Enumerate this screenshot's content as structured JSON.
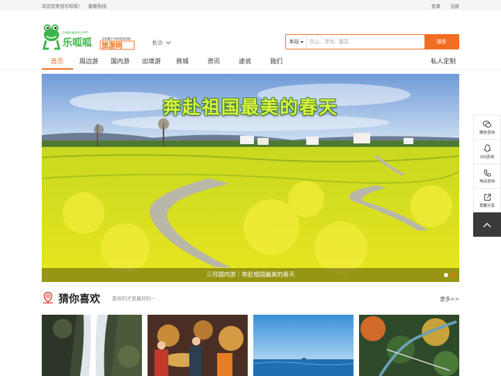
{
  "topbar": {
    "welcome": "欢迎您来到乐呱呱！",
    "hotline": "客服热线:",
    "login": "登录",
    "register": "注册"
  },
  "logo": {
    "brand": "乐呱呱",
    "domain": "Leguagua.com",
    "slogan": "定制属于你的旅游线路",
    "site": "旅游网"
  },
  "city": "长沙",
  "search": {
    "scope": "本站",
    "placeholder": "凤山、漂流、露营",
    "button": "搜索"
  },
  "nav": {
    "items": [
      "首页",
      "周边游",
      "国内游",
      "出境游",
      "商城",
      "资讯",
      "途说",
      "我们"
    ],
    "active": "首页",
    "custom": "私人定制"
  },
  "banner": {
    "title": "奔赴祖国最美的春天",
    "caption": "三月国内游｜奔赴祖国最美的春天",
    "slides": 2,
    "active_slide": 2
  },
  "side": {
    "wechat": "微信咨询",
    "qq": "QQ咨询",
    "phone": "电话咨询",
    "share": "我要分享"
  },
  "guess": {
    "title": "猜你喜欢",
    "subtitle": "喜欢的才是最好的~",
    "more": "更多>>"
  },
  "colors": {
    "accent": "#f26d22",
    "logo_green": "#3bb54a"
  }
}
